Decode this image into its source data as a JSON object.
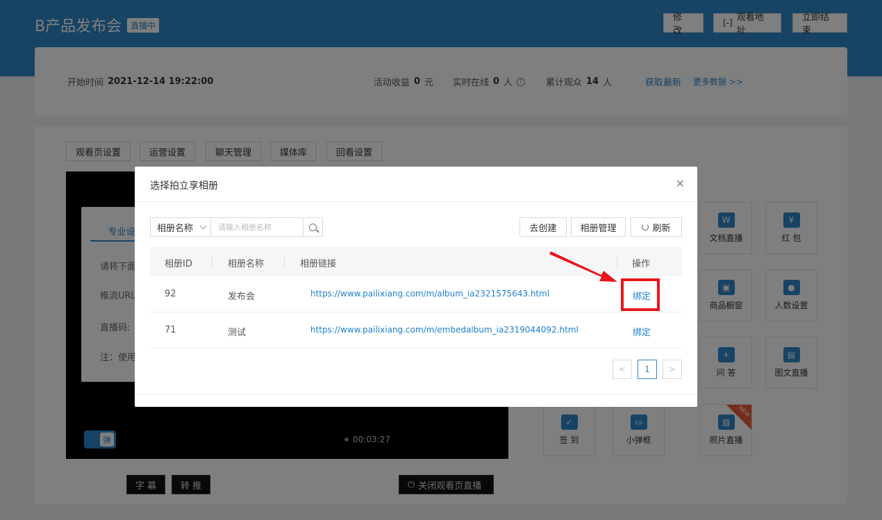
{
  "page": {
    "title": "B产品发布会",
    "live_badge": "直播中",
    "buttons": {
      "edit": "修 改",
      "watch_url": "观看地址",
      "end_now": "立即结束"
    }
  },
  "stats": {
    "start_time_label": "开始时间",
    "start_time": "2021-12-14 19:22:00",
    "revenue_label": "活动收益",
    "revenue": "0",
    "revenue_unit": "元",
    "online_label": "实时在线",
    "online": "0",
    "online_unit": "人",
    "total_label": "累计观众",
    "total": "14",
    "total_unit": "人",
    "refresh_link": "获取最新",
    "more_link": "更多数据 >>"
  },
  "tabs": [
    "观看页设置",
    "运营设置",
    "聊天管理",
    "媒体库",
    "回看设置"
  ],
  "player": {
    "inner_tab": "专业设",
    "lines": [
      "请将下面",
      "推流URL",
      "直播码:",
      "注：使用"
    ],
    "danmu_label": "弹",
    "subtitle_btn": "字 幕",
    "relay_btn": "转 推",
    "timer": "00:03:27",
    "close_btn": "关闭观看页直播"
  },
  "tools": [
    {
      "label": "文档直播",
      "icon": "W"
    },
    {
      "label": "红 包",
      "icon": "¥"
    },
    {
      "label": "商品橱窗",
      "icon": "▣"
    },
    {
      "label": "人数设置",
      "icon": "●"
    },
    {
      "label": "问 答",
      "icon": "+"
    },
    {
      "label": "图文直播",
      "icon": "▤"
    },
    {
      "label": "签 到",
      "icon": "✓"
    },
    {
      "label": "小弹框",
      "icon": "▭"
    },
    {
      "label": "照片直播",
      "icon": "▨",
      "badge": "NEW"
    }
  ],
  "modal": {
    "title": "选择拍立享相册",
    "filter_select": "相册名称",
    "search_placeholder": "请输入相册名称",
    "btn_create": "去创建",
    "btn_manage": "相册管理",
    "btn_refresh": "刷新",
    "columns": {
      "id": "相册ID",
      "name": "相册名称",
      "link": "相册链接",
      "action": "操作"
    },
    "rows": [
      {
        "id": "92",
        "name": "发布会",
        "link": "https://www.pailixiang.com/m/album_ia2321575643.html",
        "action": "绑定"
      },
      {
        "id": "71",
        "name": "测试",
        "link": "https://www.pailixiang.com/m/embedalbum_ia2319044092.html",
        "action": "绑定"
      }
    ],
    "pager": {
      "prev": "<",
      "page": "1",
      "next": ">"
    }
  },
  "colors": {
    "brand": "#2f86c8",
    "highlight": "#e6161c"
  }
}
